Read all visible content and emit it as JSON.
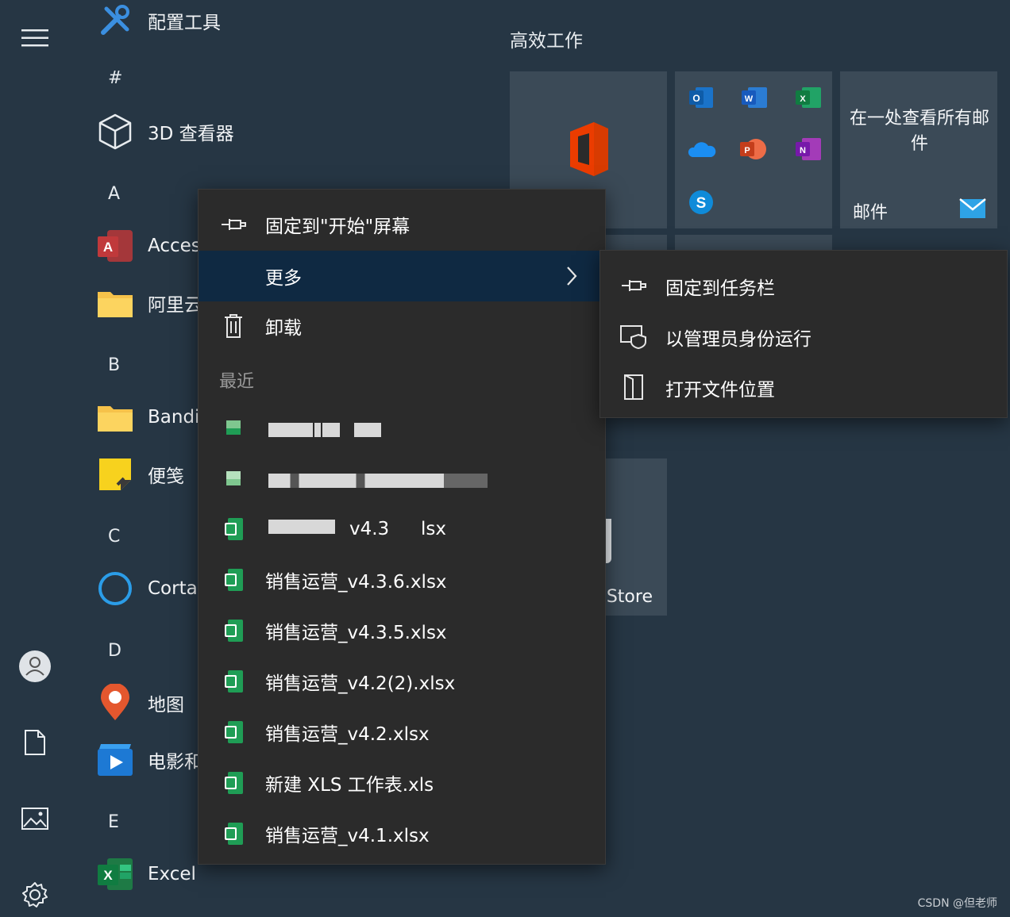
{
  "left_rail": {
    "icons": [
      "hamburger-menu-icon",
      "user-account-icon",
      "document-icon",
      "pictures-icon",
      "settings-gear-icon"
    ]
  },
  "app_list": {
    "top_app": {
      "label": "配置工具",
      "icon": "tools-icon"
    },
    "groups": [
      {
        "letter": "#",
        "apps": [
          {
            "label": "3D 查看器",
            "icon": "3d-cube-icon"
          }
        ]
      },
      {
        "letter": "A",
        "apps": [
          {
            "label": "Acces",
            "icon": "access-icon"
          },
          {
            "label": "阿里云",
            "icon": "folder-icon"
          }
        ]
      },
      {
        "letter": "B",
        "apps": [
          {
            "label": "Bandi",
            "icon": "folder-icon"
          },
          {
            "label": "便笺",
            "icon": "sticky-notes-icon"
          }
        ]
      },
      {
        "letter": "C",
        "apps": [
          {
            "label": "Corta",
            "icon": "cortana-icon"
          }
        ]
      },
      {
        "letter": "D",
        "apps": [
          {
            "label": "地图",
            "icon": "maps-pin-icon"
          },
          {
            "label": "电影和",
            "icon": "movies-icon"
          }
        ]
      },
      {
        "letter": "E",
        "apps": [
          {
            "label": "Excel",
            "icon": "excel-icon"
          }
        ]
      }
    ]
  },
  "tiles": {
    "group_title": "高效工作",
    "mail_tile": {
      "text": "在一处查看所有邮件",
      "label": "邮件"
    },
    "store_tile": {
      "label": "Store"
    }
  },
  "context_menu": {
    "pin_start": "固定到\"开始\"屏幕",
    "more": "更多",
    "uninstall": "卸载",
    "recent_header": "最近",
    "recent_files": [
      "v4.3",
      "销售运营_v4.3.6.xlsx",
      "销售运营_v4.3.5.xlsx",
      "销售运营_v4.2(2).xlsx",
      "销售运营_v4.2.xlsx",
      "新建 XLS 工作表.xls",
      "销售运营_v4.1.xlsx"
    ],
    "partial_suffix": "lsx"
  },
  "submenu": {
    "pin_taskbar": "固定到任务栏",
    "run_as_admin": "以管理员身份运行",
    "open_location": "打开文件位置"
  },
  "watermark": "CSDN @但老师",
  "colors": {
    "background": "#263644",
    "menu": "#2b2b2b",
    "menu_active": "#0f2942",
    "excel_green": "#1f9d55"
  }
}
